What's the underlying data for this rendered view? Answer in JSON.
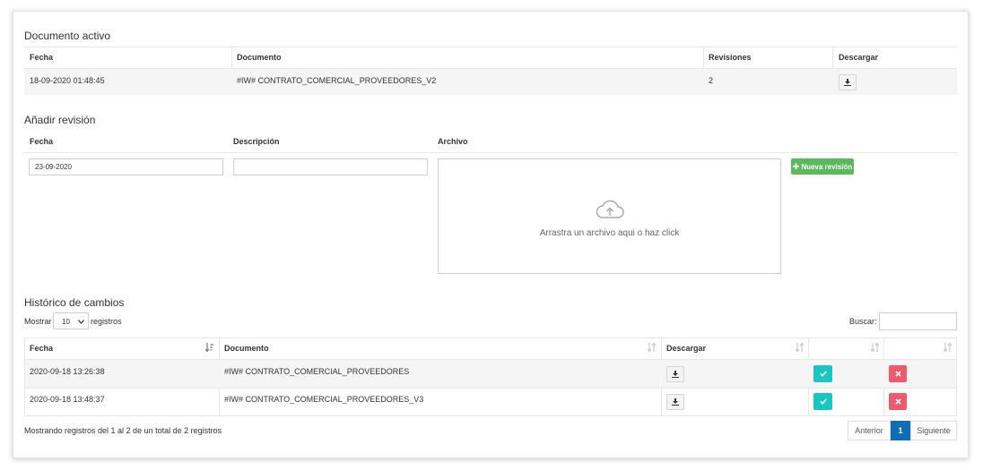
{
  "active_doc": {
    "title": "Documento activo",
    "headers": {
      "fecha": "Fecha",
      "documento": "Documento",
      "revisiones": "Revisiones",
      "descargar": "Descargar"
    },
    "row": {
      "fecha": "18-09-2020 01:48:45",
      "documento": "#IW# CONTRATO_COMERCIAL_PROVEEDORES_V2",
      "revisiones": "2"
    }
  },
  "add_revision": {
    "title": "Añadir revisión",
    "labels": {
      "fecha": "Fecha",
      "descripcion": "Descripción",
      "archivo": "Archivo"
    },
    "fecha_value": "23-09-2020",
    "descripcion_value": "",
    "dropzone_text": "Arrastra un archivo aqui o haz click",
    "button_label": "Nueva revisión"
  },
  "history": {
    "title": "Histórico de cambios",
    "show_prefix": "Mostrar",
    "page_size": "10",
    "show_suffix": "registros",
    "search_label": "Buscar:",
    "search_value": "",
    "headers": {
      "fecha": "Fecha",
      "documento": "Documento",
      "descargar": "Descargar"
    },
    "rows": [
      {
        "fecha": "2020-09-18 13:26:38",
        "documento": "#IW# CONTRATO_COMERCIAL_PROVEEDORES"
      },
      {
        "fecha": "2020-09-18 13:48:37",
        "documento": "#IW# CONTRATO_COMERCIAL_PROVEEDORES_V3"
      }
    ],
    "info": "Mostrando registros del 1 al 2 de un total de 2 registros",
    "pager": {
      "prev": "Anterior",
      "page": "1",
      "next": "Siguiente"
    }
  },
  "icons": {
    "download": "download-icon",
    "check": "check-icon",
    "close": "close-icon",
    "plus": "plus-icon",
    "cloud_upload": "cloud-upload-icon",
    "sort": "sort-icon",
    "sort_asc": "sort-asc-icon"
  },
  "colors": {
    "accent_green": "#5cb85c",
    "accent_teal": "#1bc5c0",
    "accent_red": "#ee5a6b",
    "accent_blue": "#0f6fb5"
  }
}
